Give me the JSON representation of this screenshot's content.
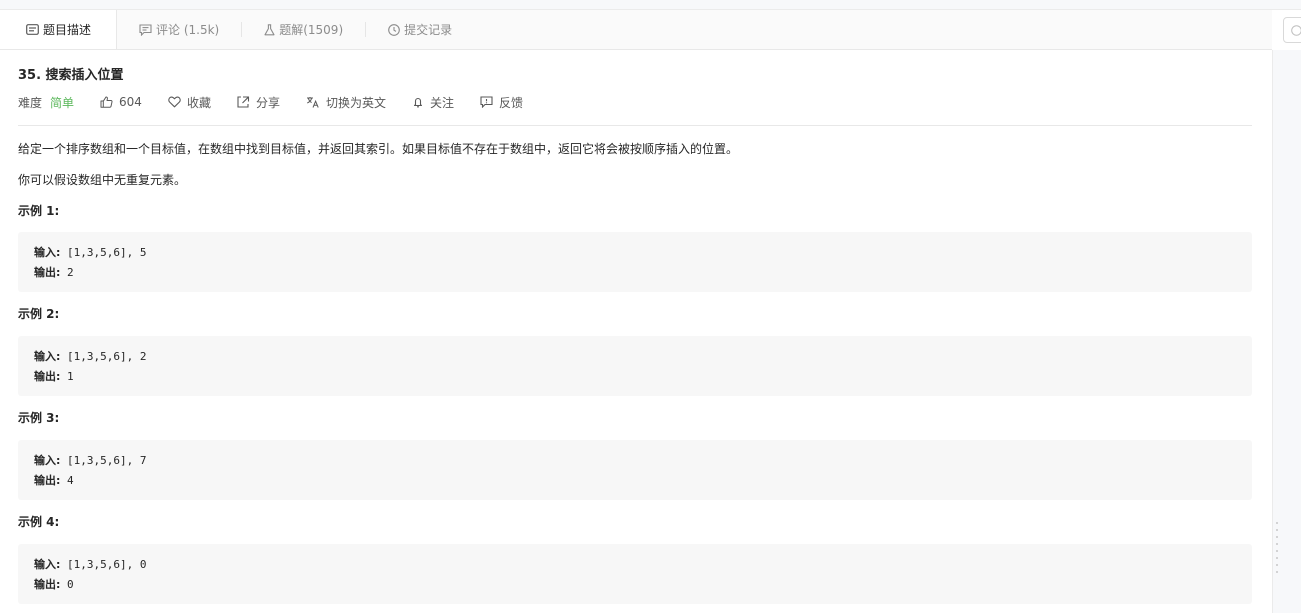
{
  "tabs": [
    {
      "label": "题目描述",
      "icon": "description-icon",
      "active": true
    },
    {
      "label": "评论 (1.5k)",
      "icon": "comment-icon",
      "active": false
    },
    {
      "label": "题解(1509)",
      "icon": "flask-icon",
      "active": false
    },
    {
      "label": "提交记录",
      "icon": "clock-icon",
      "active": false
    }
  ],
  "problem": {
    "title": "35. 搜索插入位置",
    "difficulty_label": "难度",
    "difficulty": "简单",
    "difficulty_color": "#5cb85c",
    "likes": "604",
    "favorite": "收藏",
    "share": "分享",
    "translate": "切换为英文",
    "follow": "关注",
    "feedback": "反馈"
  },
  "description": [
    "给定一个排序数组和一个目标值，在数组中找到目标值，并返回其索引。如果目标值不存在于数组中，返回它将会被按顺序插入的位置。",
    "你可以假设数组中无重复元素。"
  ],
  "examples": [
    {
      "title": "示例 1:",
      "input_label": "输入:",
      "input": "[1,3,5,6], 5",
      "output_label": "输出:",
      "output": "2"
    },
    {
      "title": "示例 2:",
      "input_label": "输入:",
      "input": "[1,3,5,6], 2",
      "output_label": "输出:",
      "output": "1"
    },
    {
      "title": "示例 3:",
      "input_label": "输入:",
      "input": "[1,3,5,6], 7",
      "output_label": "输出:",
      "output": "4"
    },
    {
      "title": "示例 4:",
      "input_label": "输入:",
      "input": "[1,3,5,6], 0",
      "output_label": "输出:",
      "output": "0"
    }
  ]
}
